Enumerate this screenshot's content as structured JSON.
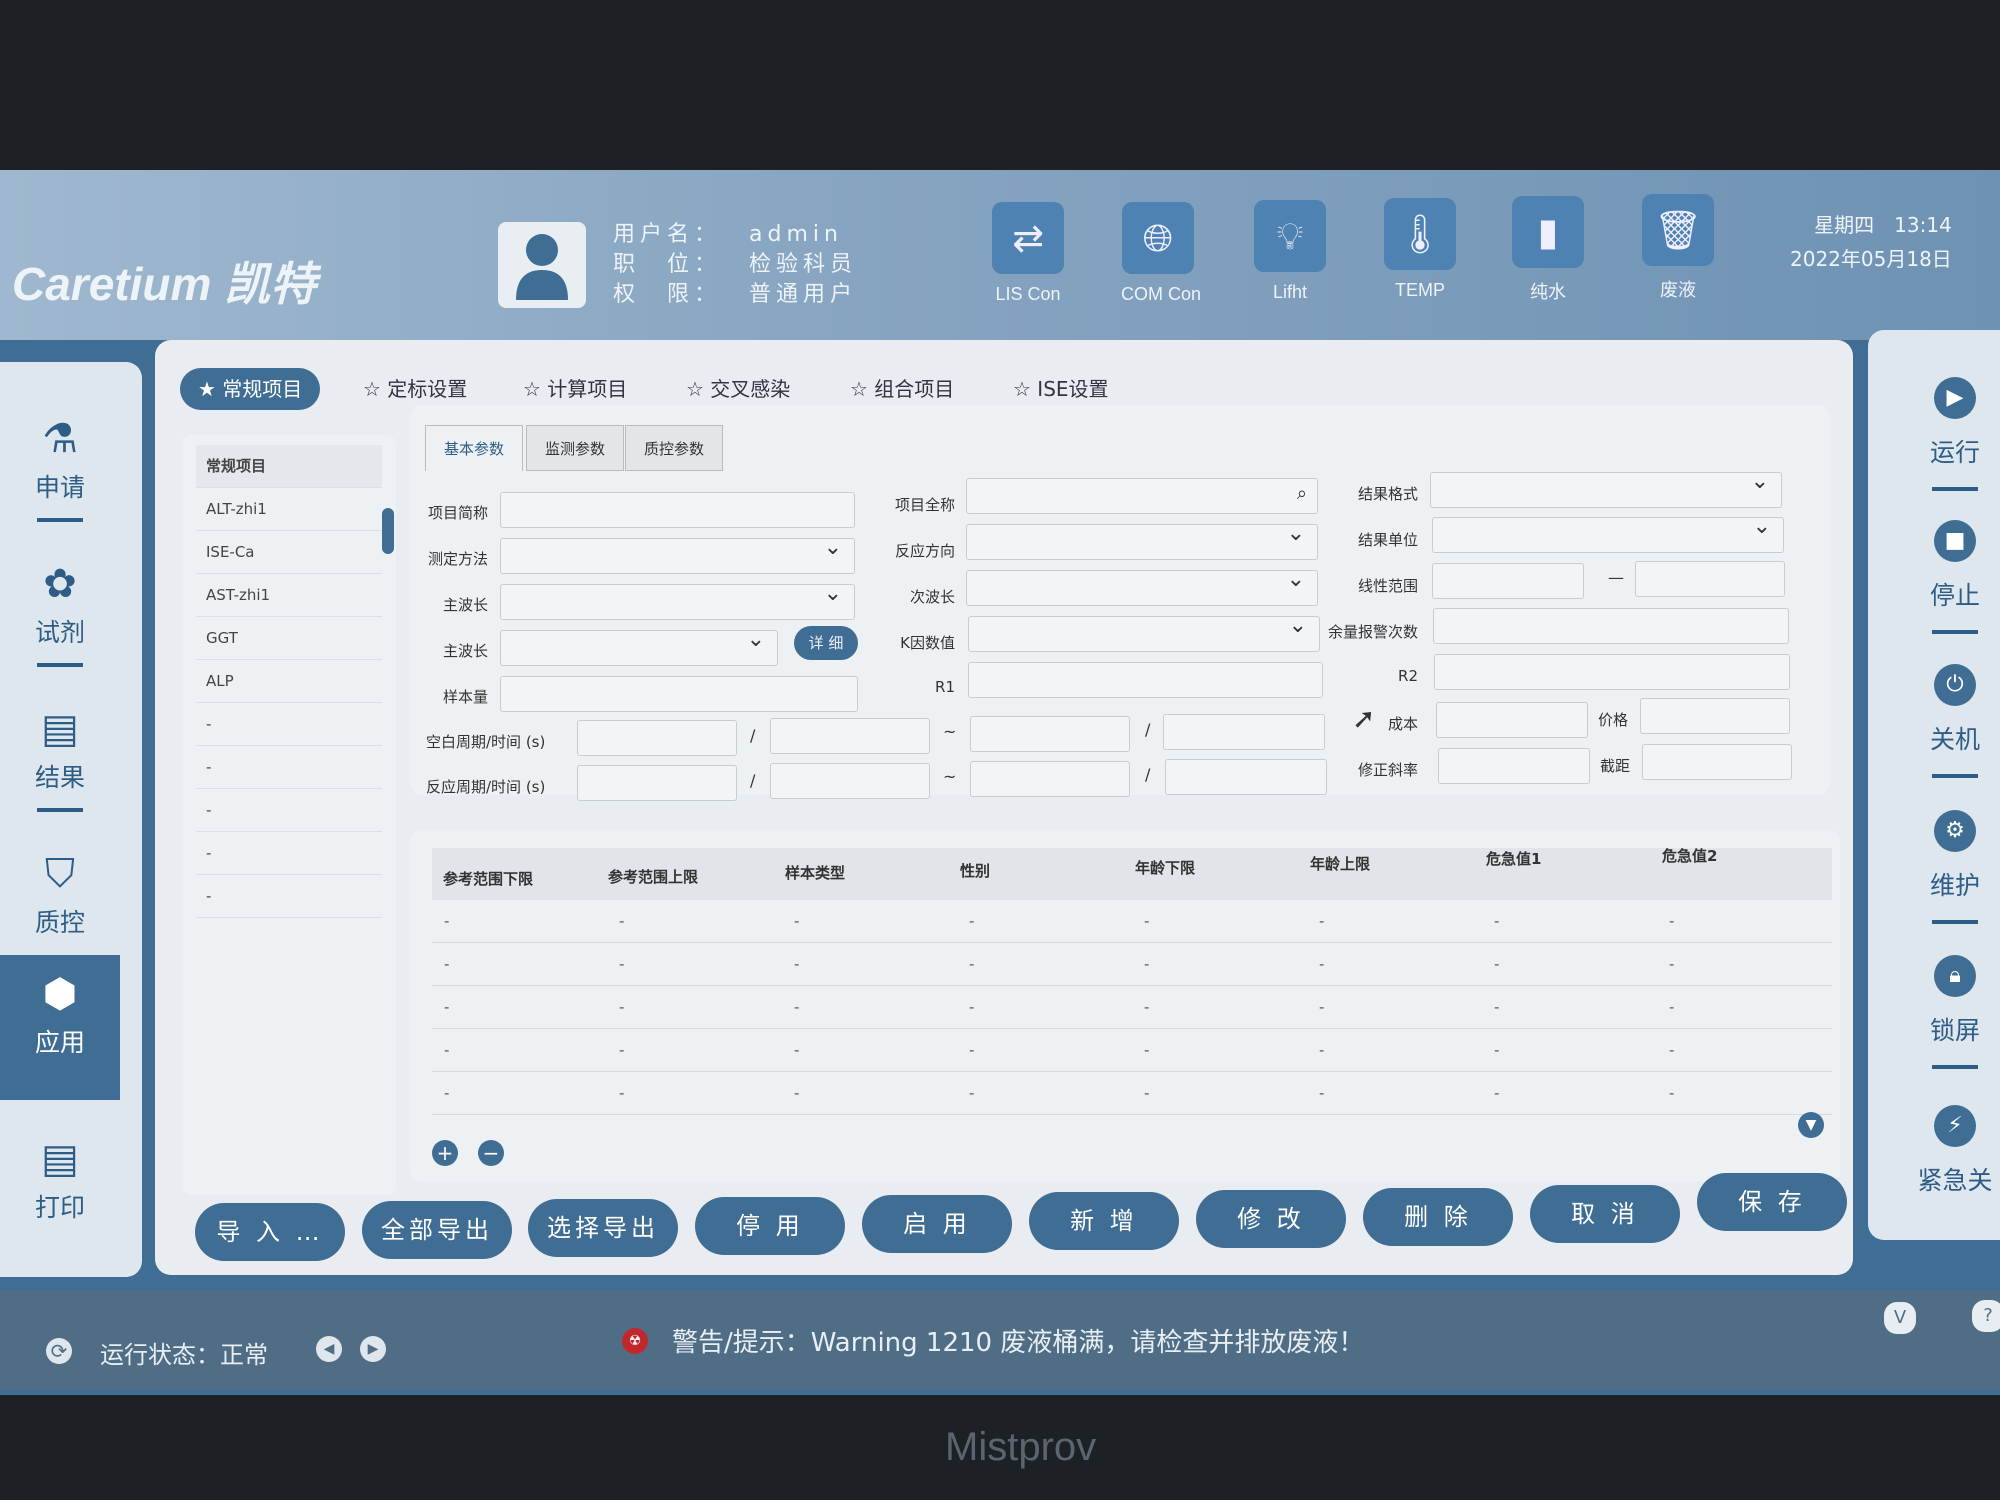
{
  "header": {
    "logo": "Caretium 凯特",
    "username_label": "用户名：",
    "username": "admin",
    "position_label": "职　位：",
    "position": "检验科员",
    "permission_label": "权　限：",
    "permission": "普通用户",
    "icons": [
      {
        "label": "LIS Con",
        "icon": "transfer-arrows-icon"
      },
      {
        "label": "COM Con",
        "icon": "globe-icon"
      },
      {
        "label": "Lifht",
        "icon": "lightbulb-icon"
      },
      {
        "label": "TEMP",
        "icon": "thermometer-icon"
      },
      {
        "label": "纯水",
        "icon": "bottle-icon"
      },
      {
        "label": "废液",
        "icon": "trash-bin-icon"
      }
    ],
    "weekday_time": "星期四　13:14",
    "date": "2022年05月18日"
  },
  "left_nav": [
    {
      "label": "申请",
      "icon": "flask-icon"
    },
    {
      "label": "试剂",
      "icon": "reagent-icon"
    },
    {
      "label": "结果",
      "icon": "result-search-icon"
    },
    {
      "label": "质控",
      "icon": "qc-shield-icon"
    },
    {
      "label": "应用",
      "icon": "app-cube-icon",
      "active": true
    },
    {
      "label": "打印",
      "icon": "print-search-icon"
    }
  ],
  "tabs": [
    "常规项目",
    "定标设置",
    "计算项目",
    "交叉感染",
    "组合项目",
    "ISE设置"
  ],
  "list": {
    "header": "常规项目",
    "items": [
      "ALT-zhi1",
      "ISE-Ca",
      "AST-zhi1",
      "GGT",
      "ALP",
      "-",
      "-",
      "-",
      "-",
      "-"
    ]
  },
  "subtabs": [
    "基本参数",
    "监测参数",
    "质控参数"
  ],
  "form": {
    "short_name": "项目简称",
    "method": "测定方法",
    "main_wave": "主波长",
    "main_wave2": "主波长",
    "detail_btn": "详 细",
    "sample_vol": "样本量",
    "blank_period": "空白周期/时间 (s)",
    "reaction_period": "反应周期/时间 (s)",
    "slash": "/",
    "tilde": "~",
    "full_name": "项目全称",
    "reaction_dir": "反应方向",
    "sub_wave": "次波长",
    "k_factor": "K因数值",
    "r1": "R1",
    "result_format": "结果格式",
    "result_unit": "结果单位",
    "linear_range": "线性范围",
    "range_dash": "—",
    "remain_alarm": "余量报警次数",
    "r2": "R2",
    "cost": "成本",
    "price": "价格",
    "slope": "修正斜率",
    "intercept": "截距"
  },
  "table": {
    "columns": [
      "参考范围下限",
      "参考范围上限",
      "样本类型",
      "性别",
      "年龄下限",
      "年龄上限",
      "危急值1",
      "危急值2"
    ],
    "rows": [
      [
        "-",
        "-",
        "-",
        "-",
        "-",
        "-",
        "-",
        "-"
      ],
      [
        "-",
        "-",
        "-",
        "-",
        "-",
        "-",
        "-",
        "-"
      ],
      [
        "-",
        "-",
        "-",
        "-",
        "-",
        "-",
        "-",
        "-"
      ],
      [
        "-",
        "-",
        "-",
        "-",
        "-",
        "-",
        "-",
        "-"
      ],
      [
        "-",
        "-",
        "-",
        "-",
        "-",
        "-",
        "-",
        "-"
      ]
    ]
  },
  "buttons": [
    "导 入 …",
    "全部导出 …",
    "选择导出 …",
    "停 用",
    "启 用",
    "新 增",
    "修 改",
    "删 除",
    "取 消",
    "保 存"
  ],
  "right_panel": [
    {
      "label": "运行",
      "icon": "play-icon"
    },
    {
      "label": "停止",
      "icon": "stop-icon"
    },
    {
      "label": "关机",
      "icon": "power-icon"
    },
    {
      "label": "维护",
      "icon": "maintenance-icon"
    },
    {
      "label": "锁屏",
      "icon": "lock-icon"
    },
    {
      "label": "紧急关",
      "icon": "emergency-icon"
    }
  ],
  "status": {
    "run_state": "运行状态：正常",
    "warning": "警告/提示：Warning 1210 废液桶满，请检查并排放废液！",
    "v_btn": "V",
    "help_btn": "?"
  },
  "bezel_brand": "Mistprov",
  "colors": {
    "primary": "#3f6d93",
    "panel": "#e9edf1",
    "warning": "#c0282d"
  }
}
